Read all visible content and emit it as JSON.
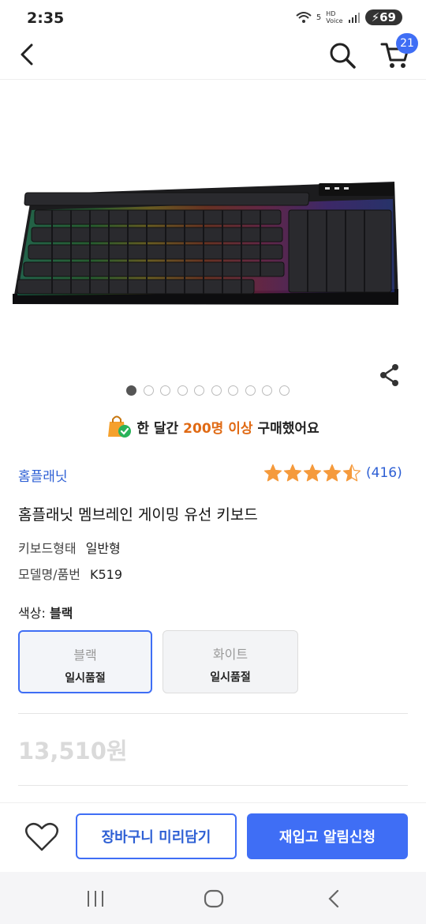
{
  "status": {
    "time": "2:35",
    "network": "5",
    "hd": "HD",
    "voice": "Voice",
    "battery": "69"
  },
  "header": {
    "cart_count": "21"
  },
  "icons": {
    "back": "chevron-left-icon",
    "search": "search-icon",
    "cart": "cart-icon",
    "share": "share-icon",
    "bag": "shopping-bag-check-icon",
    "heart": "heart-icon",
    "recents": "recents-icon",
    "home": "home-icon",
    "nav_back": "back-icon"
  },
  "carousel": {
    "total": 10,
    "active": 1
  },
  "notice": {
    "prefix": "한 달간",
    "highlight": "200명 이상",
    "suffix": "구매했어요"
  },
  "product": {
    "brand": "홈플래닛",
    "rating_count": "(416)",
    "rating": 4.5,
    "title": "홈플래닛 멤브레인 게이밍 유선 키보드",
    "specs": [
      {
        "label": "키보드형태",
        "value": "일반형"
      },
      {
        "label": "모델명/품번",
        "value": "K519"
      }
    ],
    "color_label": "색상:",
    "color_value": "블랙",
    "options": [
      {
        "name": "블랙",
        "state": "일시품절"
      },
      {
        "name": "화이트",
        "state": "일시품절"
      }
    ],
    "price": "13,510원"
  },
  "actions": {
    "cart_button": "장바구니 미리담기",
    "alert_button": "재입고 알림신청"
  },
  "colors": {
    "accent": "#3f6ef5",
    "highlight": "#e06a14",
    "star": "#f59a3c"
  }
}
